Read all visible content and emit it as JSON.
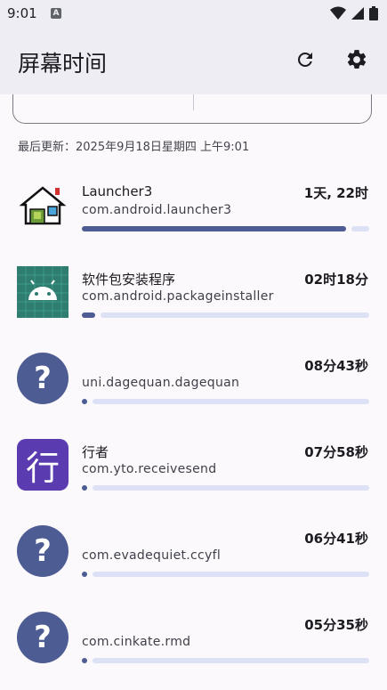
{
  "status": {
    "time": "9:01",
    "notif_letter": "A"
  },
  "appbar": {
    "title": "屏幕时间"
  },
  "last_updated": "最后更新：2025年9月18日星期四 上午9:01",
  "colors": {
    "accent": "#4d5c92",
    "track": "#dce1f6"
  },
  "apps": [
    {
      "name": "Launcher3",
      "package": "com.android.launcher3",
      "time": "1天, 22时",
      "icon": "house-icon",
      "progress": 1.0
    },
    {
      "name": "软件包安装程序",
      "package": "com.android.packageinstaller",
      "time": "02时18分",
      "icon": "android-icon",
      "progress": 0.05
    },
    {
      "name": "",
      "package": "uni.dagequan.dagequan",
      "time": "08分43秒",
      "icon": "question-icon",
      "progress": 0.003
    },
    {
      "name": "行者",
      "package": "com.yto.receivesend",
      "time": "07分58秒",
      "icon": "xing-icon",
      "progress": 0.003
    },
    {
      "name": "",
      "package": "com.evadequiet.ccyfl",
      "time": "06分41秒",
      "icon": "question-icon",
      "progress": 0.002
    },
    {
      "name": "",
      "package": "com.cinkate.rmd",
      "time": "05分35秒",
      "icon": "question-icon",
      "progress": 0.002
    }
  ]
}
